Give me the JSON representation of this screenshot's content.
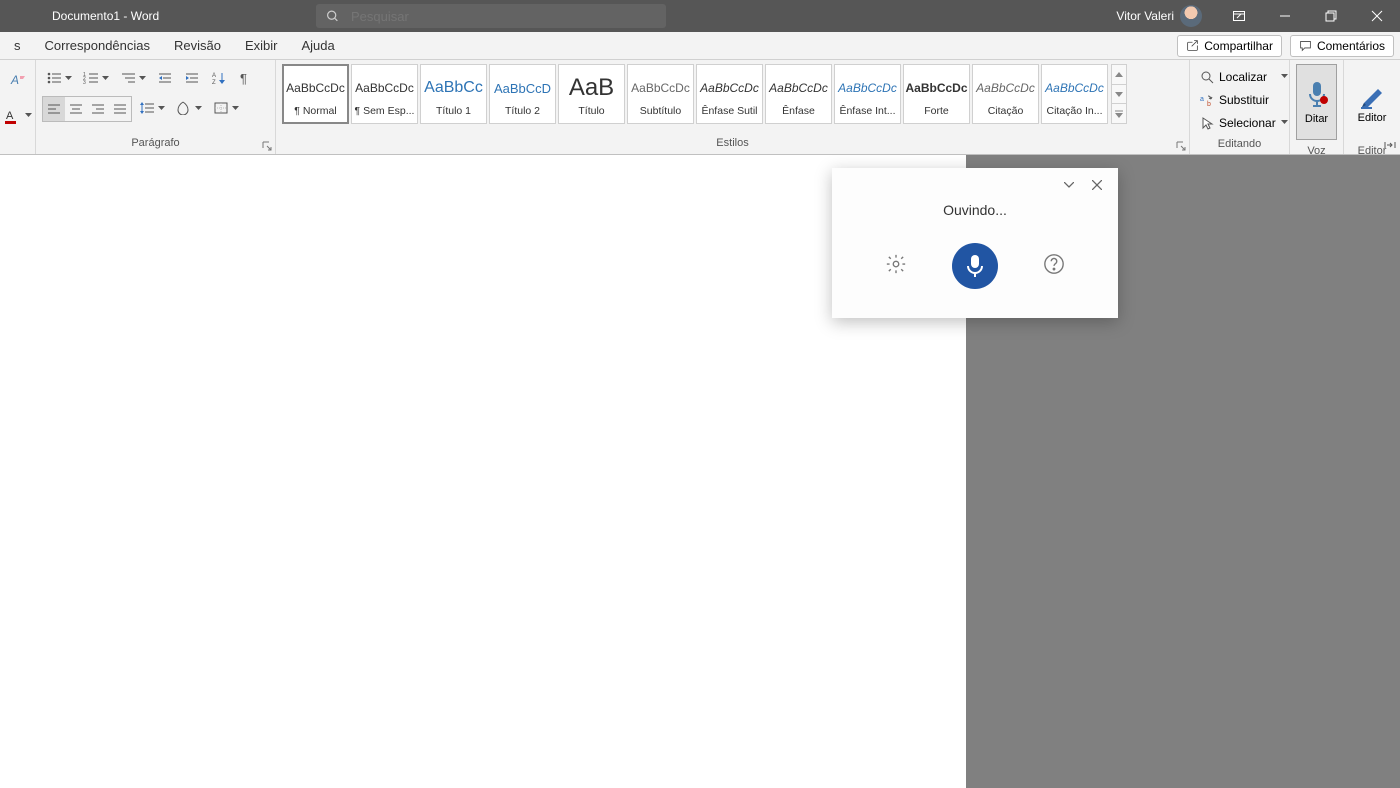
{
  "title": "Documento1  -  Word",
  "search_placeholder": "Pesquisar",
  "user_name": "Vitor Valeri",
  "tabs": {
    "left": [
      "s",
      "Correspondências",
      "Revisão",
      "Exibir",
      "Ajuda"
    ],
    "share": "Compartilhar",
    "comments": "Comentários"
  },
  "groups": {
    "paragraph": "Parágrafo",
    "styles": "Estilos",
    "editing": "Editando",
    "voice": "Voz",
    "editor": "Editor"
  },
  "styles": [
    {
      "preview": "AaBbCcDc",
      "name": "¶ Normal",
      "color": "#333",
      "size": "12px"
    },
    {
      "preview": "AaBbCcDc",
      "name": "¶ Sem Esp...",
      "color": "#333",
      "size": "12px"
    },
    {
      "preview": "AaBbCc",
      "name": "Título 1",
      "color": "#2e74b5",
      "size": "16px"
    },
    {
      "preview": "AaBbCcD",
      "name": "Título 2",
      "color": "#2e74b5",
      "size": "13px"
    },
    {
      "preview": "AaB",
      "name": "Título",
      "color": "#333",
      "size": "24px"
    },
    {
      "preview": "AaBbCcDc",
      "name": "Subtítulo",
      "color": "#666",
      "size": "12px"
    },
    {
      "preview": "AaBbCcDc",
      "name": "Ênfase Sutil",
      "color": "#333",
      "size": "12px",
      "italic": true
    },
    {
      "preview": "AaBbCcDc",
      "name": "Ênfase",
      "color": "#333",
      "size": "12px",
      "italic": true
    },
    {
      "preview": "AaBbCcDc",
      "name": "Ênfase Int...",
      "color": "#2e74b5",
      "size": "12px",
      "italic": true
    },
    {
      "preview": "AaBbCcDc",
      "name": "Forte",
      "color": "#333",
      "size": "12px",
      "bold": true
    },
    {
      "preview": "AaBbCcDc",
      "name": "Citação",
      "color": "#666",
      "size": "12px",
      "italic": true
    },
    {
      "preview": "AaBbCcDc",
      "name": "Citação In...",
      "color": "#2e74b5",
      "size": "12px",
      "italic": true
    }
  ],
  "editing": {
    "find": "Localizar",
    "replace": "Substituir",
    "select": "Selecionar"
  },
  "big_buttons": {
    "dictate": "Ditar",
    "editor": "Editor"
  },
  "dictation": {
    "status": "Ouvindo..."
  }
}
